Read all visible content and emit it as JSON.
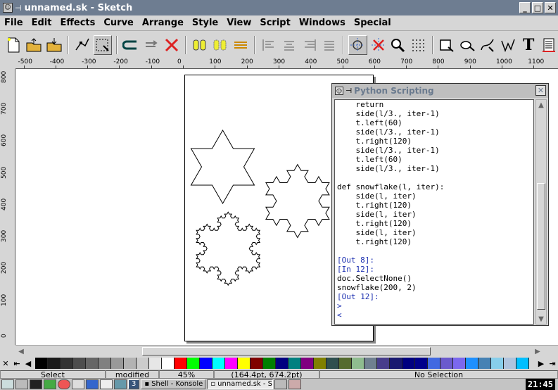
{
  "window": {
    "title": "unnamed.sk - Sketch",
    "buttons": [
      "_",
      "□",
      "✕"
    ]
  },
  "menu": [
    "File",
    "Edit",
    "Effects",
    "Curve",
    "Arrange",
    "Style",
    "View",
    "Script",
    "Windows",
    "Special"
  ],
  "toolbar": {
    "icons": [
      "new-file-icon",
      "open-file-icon",
      "save-file-icon",
      "edit-tool-icon",
      "select-tool-icon",
      "undo-icon",
      "redo-icon",
      "delete-icon",
      "group-icon",
      "ungroup-icon",
      "combine-icon",
      "align-left-icon",
      "align-center-icon",
      "align-right-icon",
      "align-justify-icon",
      "snap-grid-icon",
      "snap-off-icon",
      "zoom-icon",
      "grid-icon",
      "rectangle-tool-icon",
      "ellipse-tool-icon",
      "bezier-tool-icon",
      "freehand-tool-icon",
      "text-tool-icon",
      "layers-icon"
    ],
    "text_tool_label": "T"
  },
  "ruler": {
    "h_labels": [
      "-500",
      "-400",
      "-300",
      "-200",
      "-100",
      "0",
      "100",
      "200",
      "300",
      "400",
      "500",
      "600",
      "700",
      "800",
      "900",
      "1000",
      "1100"
    ],
    "v_labels": [
      "800",
      "700",
      "600",
      "500",
      "400",
      "300",
      "200",
      "100",
      "0"
    ]
  },
  "python": {
    "title": "Python Scripting",
    "close": "✕",
    "lines": [
      {
        "text": "    return",
        "blue": false
      },
      {
        "text": "    side(l/3., iter-1)",
        "blue": false
      },
      {
        "text": "    t.left(60)",
        "blue": false
      },
      {
        "text": "    side(l/3., iter-1)",
        "blue": false
      },
      {
        "text": "    t.right(120)",
        "blue": false
      },
      {
        "text": "    side(l/3., iter-1)",
        "blue": false
      },
      {
        "text": "    t.left(60)",
        "blue": false
      },
      {
        "text": "    side(l/3., iter-1)",
        "blue": false
      },
      {
        "text": "",
        "blue": false
      },
      {
        "text": "def snowflake(l, iter):",
        "blue": false
      },
      {
        "text": "    side(l, iter)",
        "blue": false
      },
      {
        "text": "    t.right(120)",
        "blue": false
      },
      {
        "text": "    side(l, iter)",
        "blue": false
      },
      {
        "text": "    t.right(120)",
        "blue": false
      },
      {
        "text": "    side(l, iter)",
        "blue": false
      },
      {
        "text": "    t.right(120)",
        "blue": false
      },
      {
        "text": "",
        "blue": false
      },
      {
        "text": "[Out 8]:",
        "blue": true
      },
      {
        "text": "[In 12]:",
        "blue": true
      },
      {
        "text": "doc.SelectNone()",
        "blue": false
      },
      {
        "text": "snowflake(200, 2)",
        "blue": false
      },
      {
        "text": "[Out 12]:",
        "blue": true
      },
      {
        "text": ">",
        "blue": true
      },
      {
        "text": "<",
        "blue": true
      }
    ]
  },
  "palette": {
    "colors": [
      "#000000",
      "#1a1a1a",
      "#333333",
      "#4d4d4d",
      "#666666",
      "#808080",
      "#999999",
      "#b3b3b3",
      "#cccccc",
      "#e6e6e6",
      "#ffffff",
      "#ff0000",
      "#00ff00",
      "#0000ff",
      "#00ffff",
      "#ff00ff",
      "#ffff00",
      "#800000",
      "#008000",
      "#000080",
      "#008080",
      "#800080",
      "#808000",
      "#2f4f4f",
      "#556b2f",
      "#8fbc8f",
      "#708090",
      "#483d8b",
      "#191970",
      "#000080",
      "#00008b",
      "#4169e1",
      "#6a5acd",
      "#7b68ee",
      "#1e90ff",
      "#4682b4",
      "#87ceeb",
      "#b0c4de",
      "#00bfff"
    ]
  },
  "status": {
    "mode": "Select",
    "modified": "modified",
    "zoom": "45%",
    "coords": "(164.4pt, 674.2pt)",
    "selection": "No Selection"
  },
  "taskbar": {
    "desktop": "3",
    "tasks": [
      "Shell - Konsole",
      "unnamed.sk - Sketch"
    ],
    "clock": "21:45"
  }
}
